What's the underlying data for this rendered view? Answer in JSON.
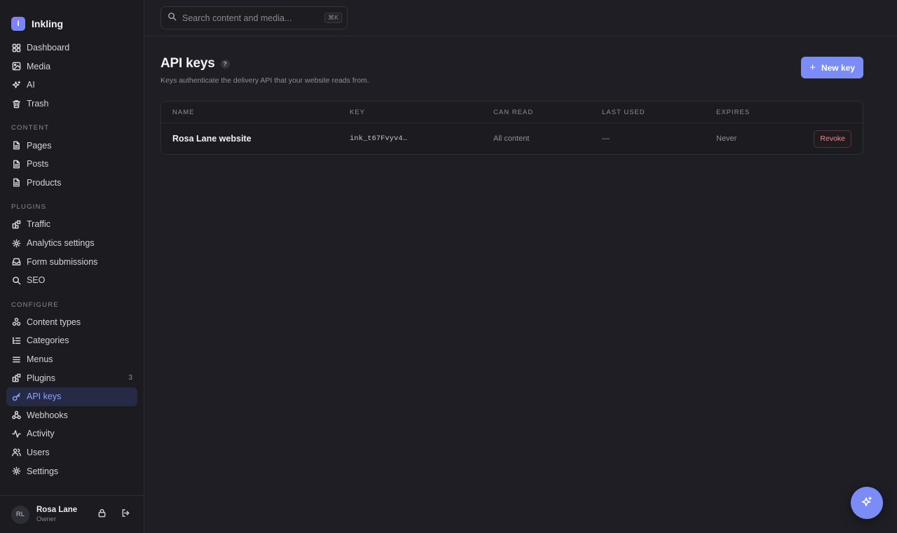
{
  "brand": {
    "logo_letter": "I",
    "name": "Inkling"
  },
  "nav": {
    "primary": [
      {
        "label": "Dashboard"
      },
      {
        "label": "Media"
      },
      {
        "label": "AI"
      },
      {
        "label": "Trash"
      }
    ],
    "content": {
      "label": "CONTENT",
      "items": [
        {
          "label": "Pages"
        },
        {
          "label": "Posts"
        },
        {
          "label": "Products"
        }
      ]
    },
    "plugins": {
      "label": "PLUGINS",
      "items": [
        {
          "label": "Traffic"
        },
        {
          "label": "Analytics settings"
        },
        {
          "label": "Form submissions"
        },
        {
          "label": "SEO"
        }
      ]
    },
    "configure": {
      "label": "CONFIGURE",
      "items": [
        {
          "label": "Content types"
        },
        {
          "label": "Categories"
        },
        {
          "label": "Menus"
        },
        {
          "label": "Plugins",
          "count": "3"
        },
        {
          "label": "API keys"
        },
        {
          "label": "Webhooks"
        },
        {
          "label": "Activity"
        },
        {
          "label": "Users"
        },
        {
          "label": "Settings"
        }
      ]
    }
  },
  "user": {
    "initials": "RL",
    "name": "Rosa Lane",
    "role": "Owner"
  },
  "search": {
    "placeholder": "Search content and media...",
    "value": "",
    "shortcut": "⌘K"
  },
  "page": {
    "title": "API keys",
    "help": "?",
    "subtitle": "Keys authenticate the delivery API that your website reads from.",
    "new_button": "New key"
  },
  "table": {
    "headers": [
      "NAME",
      "KEY",
      "CAN READ",
      "LAST USED",
      "EXPIRES"
    ],
    "rows": [
      {
        "name": "Rosa Lane website",
        "key": "ink_t67Fvyv4…",
        "can_read": "All content",
        "last_used": "—",
        "expires": "Never",
        "action": "Revoke"
      }
    ]
  },
  "colors": {
    "accent": "#7b8cf7",
    "active_bg": "#262a44",
    "active_text": "#8ea2ff",
    "danger": "#f08a94"
  }
}
